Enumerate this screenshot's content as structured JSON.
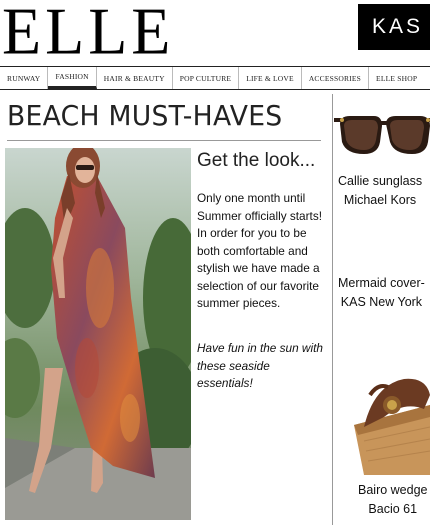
{
  "header": {
    "logo": "ELLE",
    "brand": "KAS"
  },
  "nav": [
    {
      "label": "RUNWAY"
    },
    {
      "label": "FASHION",
      "active": true
    },
    {
      "label": "HAIR & BEAUTY"
    },
    {
      "label": "POP CULTURE"
    },
    {
      "label": "LIFE & LOVE"
    },
    {
      "label": "ACCESSORIES"
    },
    {
      "label": "ELLE SHOP"
    }
  ],
  "article": {
    "headline": "BEACH MUST-HAVES",
    "subtitle": "Get the look...",
    "body": "Only one month until Summer officially starts! In order for you to be both comfortable and stylish we have made a selection of our favorite summer pieces.",
    "closing": "Have fun in the sun with these seaside essentials!"
  },
  "products": [
    {
      "line1": "Callie sunglass",
      "line2": "Michael Kors"
    },
    {
      "line1": "Mermaid cover-",
      "line2": "KAS New York"
    },
    {
      "line1": "Bairo wedge",
      "line2": "Bacio 61"
    }
  ]
}
